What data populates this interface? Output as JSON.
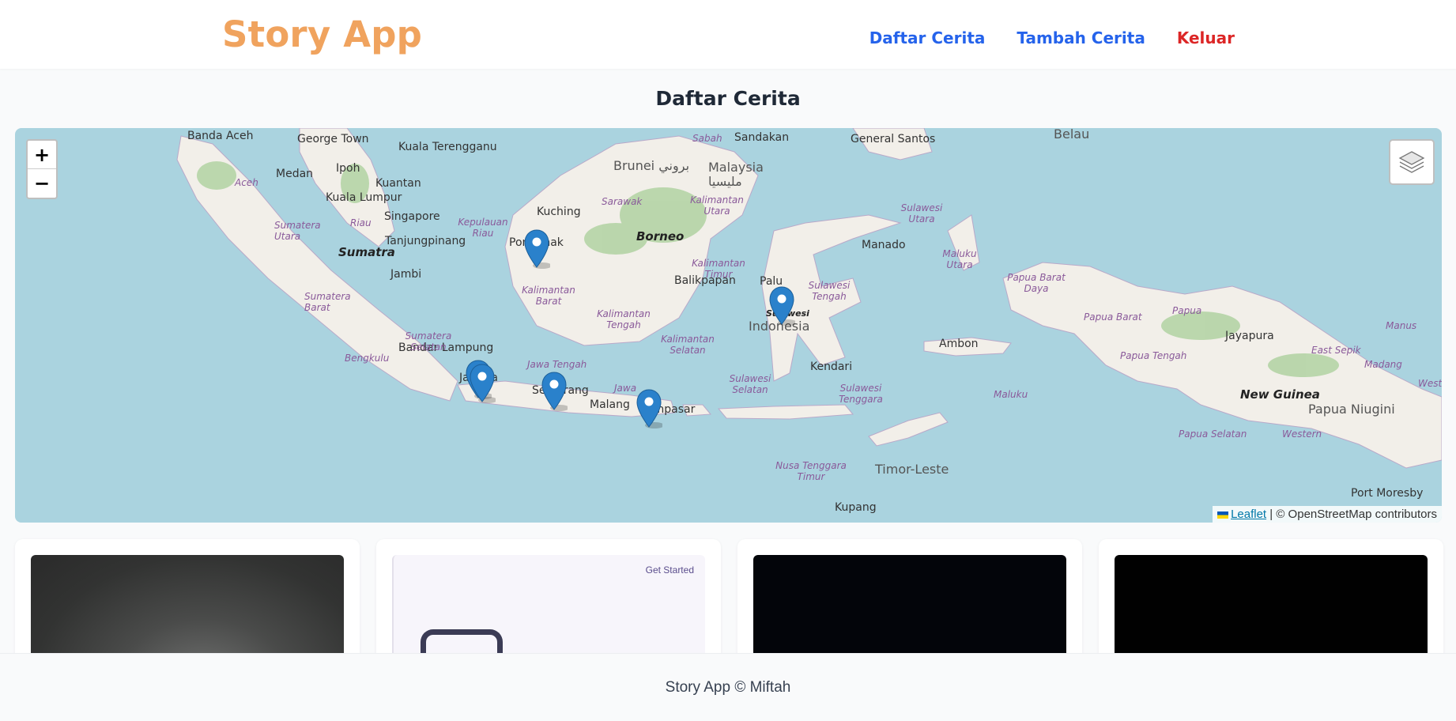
{
  "header": {
    "brand": "Story App",
    "nav": [
      {
        "label": "Daftar Cerita"
      },
      {
        "label": "Tambah Cerita"
      },
      {
        "label": "Keluar"
      }
    ]
  },
  "page": {
    "title": "Daftar Cerita"
  },
  "map": {
    "zoom_in": "+",
    "zoom_out": "−",
    "attribution_leaflet": "Leaflet",
    "attribution_rest": " | © OpenStreetMap contributors",
    "labels": {
      "banda_aceh": "Banda Aceh",
      "george_town": "George Town",
      "kuala_terengganu": "Kuala Terengganu",
      "medan": "Medan",
      "ipoh": "Ipoh",
      "kuantan": "Kuantan",
      "kuala_lumpur": "Kuala Lumpur",
      "singapore": "Singapore",
      "tanjungpinang": "Tanjungpinang",
      "sumatra": "Sumatra",
      "jambi": "Jambi",
      "bandar_lampung": "Bandar Lampung",
      "jakarta": "Jakarta",
      "semarang": "Semarang",
      "malang": "Malang",
      "denpasar": "Denpasar",
      "pontianak": "Pontianak",
      "kuching": "Kuching",
      "borneo": "Borneo",
      "brunei": "Brunei بروني",
      "malaysia": "Malaysia",
      "malaysia_ar": "مليسيا",
      "sabah": "Sabah",
      "sandakan": "Sandakan",
      "balikpapan": "Balikpapan",
      "palu": "Palu",
      "indonesia": "Indonesia",
      "sulawesi": "Sulawesi",
      "kendari": "Kendari",
      "manado": "Manado",
      "general_santos": "General Santos",
      "belau": "Belau",
      "ambon": "Ambon",
      "jayapura": "Jayapura",
      "new_guinea": "New Guinea",
      "papua_nugini": "Papua Niugini",
      "timor_leste": "Timor-Leste",
      "kupang": "Kupang",
      "port_moresby": "Port Moresby",
      "madang": "Madang",
      "manus": "Manus",
      "west": "West",
      "sarawak": "Sarawak",
      "aceh": "Aceh",
      "sumatera_utara": "Sumatera Utara",
      "riau": "Riau",
      "kepulauan_riau": "Kepulauan Riau",
      "sumatera_barat": "Sumatera Barat",
      "sumatera_selatan": "Sumatera Selatan",
      "bengkulu": "Bengkulu",
      "jawa_tengah": "Jawa Tengah",
      "jawa": "Jawa",
      "kalimantan_barat": "Kalimantan Barat",
      "kalimantan_tengah": "Kalimantan Tengah",
      "kalimantan_selatan": "Kalimantan Selatan",
      "kalimantan_timur": "Kalimantan Timur",
      "kalimantan_utara": "Kalimantan Utara",
      "sulawesi_utara": "Sulawesi Utara",
      "sulawesi_tengah": "Sulawesi Tengah",
      "sulawesi_selatan": "Sulawesi Selatan",
      "sulawesi_tenggara": "Sulawesi Tenggara",
      "maluku_utara": "Maluku Utara",
      "maluku": "Maluku",
      "papua_barat_daya": "Papua Barat Daya",
      "papua_barat": "Papua Barat",
      "papua": "Papua",
      "papua_tengah": "Papua Tengah",
      "papua_selatan": "Papua Selatan",
      "east_sepik": "East Sepik",
      "western": "Western",
      "nusa_tenggara_timur": "Nusa Tenggara Timur"
    }
  },
  "cards": [
    {
      "alt": "story-photo-1"
    },
    {
      "cta": "Get Started"
    },
    {
      "alt": "story-photo-3"
    },
    {
      "alt": "story-photo-4"
    }
  ],
  "footer": {
    "text": "Story App © Miftah"
  }
}
